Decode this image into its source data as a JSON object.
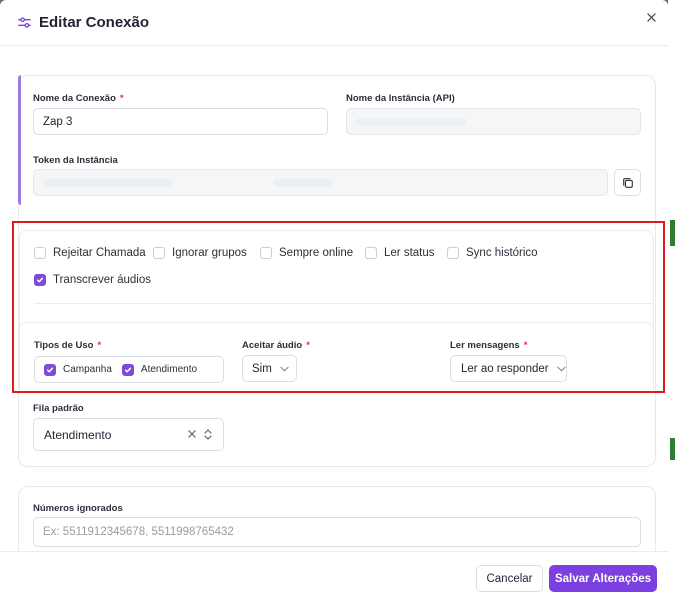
{
  "modal": {
    "title": "Editar Conexão",
    "close_icon": "close-icon",
    "title_icon": "sliders-icon"
  },
  "connection": {
    "name_label": "Nome da Conexão",
    "name_value": "Zap 3",
    "required_mark": "*",
    "instance_label": "Nome da Instância (API)",
    "token_label": "Token da Instância",
    "copy_icon": "copy-icon"
  },
  "options": {
    "checkboxes": [
      {
        "label": "Rejeitar Chamada",
        "checked": false
      },
      {
        "label": "Ignorar grupos",
        "checked": false
      },
      {
        "label": "Sempre online",
        "checked": false
      },
      {
        "label": "Ler status",
        "checked": false
      },
      {
        "label": "Sync histórico",
        "checked": false
      },
      {
        "label": "Transcrever áudios",
        "checked": true
      }
    ]
  },
  "usage": {
    "tipos_label": "Tipos de Uso",
    "tipos": [
      {
        "label": "Campanha",
        "checked": true
      },
      {
        "label": "Atendimento",
        "checked": true
      }
    ],
    "audio_label": "Aceitar áudio",
    "audio_value": "Sim",
    "read_label": "Ler mensagens",
    "read_value": "Ler ao responder"
  },
  "queue": {
    "label": "Fila padrão",
    "value": "Atendimento"
  },
  "ignored": {
    "label": "Números ignorados",
    "placeholder": "Ex: 5511912345678, 5511998765432"
  },
  "footer": {
    "cancel_label": "Cancelar",
    "save_label": "Salvar Alterações"
  },
  "colors": {
    "accent": "#7c3fe0",
    "highlight_frame": "#e01b1b"
  }
}
